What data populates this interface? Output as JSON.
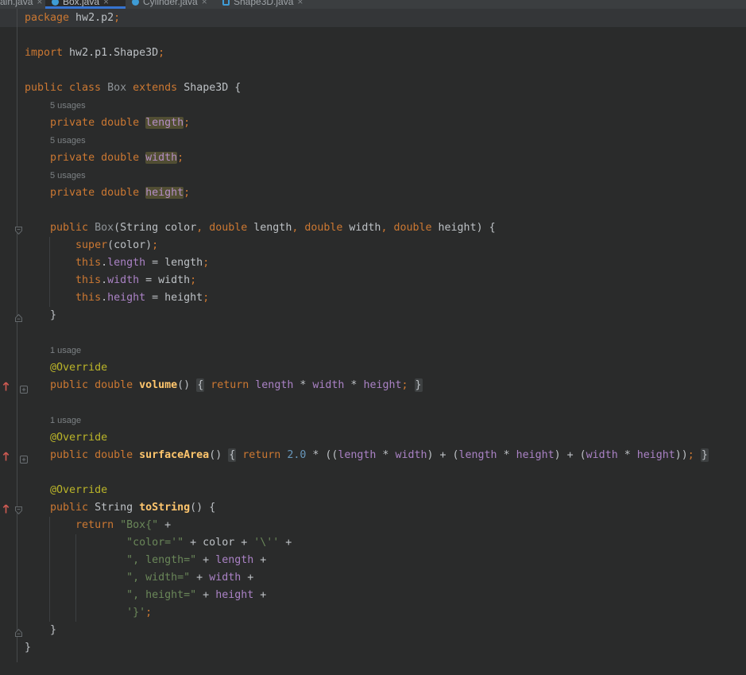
{
  "colors": {
    "editor_background": "#2a2b2b",
    "tabbar_background": "#3b3e40",
    "active_tab_underline": "#3674d0",
    "current_line_highlight": "#343638",
    "keyword": "#cc7832",
    "field": "#aa82c5",
    "field_usage_highlight": "#514e33",
    "method_declaration": "#ffc66d",
    "annotation": "#bbb529",
    "string": "#6a8759",
    "number": "#6897bb",
    "override_arrow": "#ce5a52",
    "java_class_icon_blue": "#3e9cd6"
  },
  "tabs": {
    "items": [
      {
        "label": "ain.java",
        "close": "×",
        "icon": "none",
        "active": false
      },
      {
        "label": "Box.java",
        "close": "×",
        "icon": "java-class",
        "active": true
      },
      {
        "label": "Cylinder.java",
        "close": "×",
        "icon": "java-class",
        "active": false
      },
      {
        "label": "Shape3D.java",
        "close": "×",
        "icon": "java-abstract-class",
        "active": false
      }
    ]
  },
  "editor": {
    "lines": [
      {
        "cur": true,
        "s": [
          [
            "kw",
            "package"
          ],
          [
            "def",
            " hw2.p2"
          ],
          [
            "kw",
            ";"
          ]
        ]
      },
      {
        "s": []
      },
      {
        "s": [
          [
            "kw",
            "import"
          ],
          [
            "def",
            " hw2.p1.Shape3D"
          ],
          [
            "kw",
            ";"
          ]
        ]
      },
      {
        "s": []
      },
      {
        "s": [
          [
            "kw",
            "public class"
          ],
          [
            "def",
            " "
          ],
          [
            "gray",
            "Box"
          ],
          [
            "def",
            " "
          ],
          [
            "kw",
            "extends"
          ],
          [
            "def",
            " Shape3D {"
          ]
        ]
      },
      {
        "inlay": "5 usages"
      },
      {
        "s": [
          [
            "def",
            "    "
          ],
          [
            "kw",
            "private double"
          ],
          [
            "def",
            " "
          ],
          [
            "fldhl",
            "length"
          ],
          [
            "kw",
            ";"
          ]
        ]
      },
      {
        "inlay": "5 usages"
      },
      {
        "s": [
          [
            "def",
            "    "
          ],
          [
            "kw",
            "private double"
          ],
          [
            "def",
            " "
          ],
          [
            "fldhl",
            "width"
          ],
          [
            "kw",
            ";"
          ]
        ]
      },
      {
        "inlay": "5 usages"
      },
      {
        "s": [
          [
            "def",
            "    "
          ],
          [
            "kw",
            "private double"
          ],
          [
            "def",
            " "
          ],
          [
            "fldhl",
            "height"
          ],
          [
            "kw",
            ";"
          ]
        ]
      },
      {
        "s": []
      },
      {
        "g": [
          "fold-start"
        ],
        "s": [
          [
            "def",
            "    "
          ],
          [
            "kw",
            "public"
          ],
          [
            "def",
            " "
          ],
          [
            "gray",
            "Box"
          ],
          [
            "def",
            "(String color"
          ],
          [
            "kw",
            ","
          ],
          [
            "def",
            " "
          ],
          [
            "kw",
            "double"
          ],
          [
            "def",
            " length"
          ],
          [
            "kw",
            ","
          ],
          [
            "def",
            " "
          ],
          [
            "kw",
            "double"
          ],
          [
            "def",
            " width"
          ],
          [
            "kw",
            ","
          ],
          [
            "def",
            " "
          ],
          [
            "kw",
            "double"
          ],
          [
            "def",
            " height) {"
          ]
        ]
      },
      {
        "s": [
          [
            "def",
            "        "
          ],
          [
            "kw",
            "super"
          ],
          [
            "def",
            "(color)"
          ],
          [
            "kw",
            ";"
          ]
        ]
      },
      {
        "s": [
          [
            "def",
            "        "
          ],
          [
            "kw",
            "this"
          ],
          [
            "def",
            "."
          ],
          [
            "fld",
            "length"
          ],
          [
            "def",
            " = length"
          ],
          [
            "kw",
            ";"
          ]
        ]
      },
      {
        "s": [
          [
            "def",
            "        "
          ],
          [
            "kw",
            "this"
          ],
          [
            "def",
            "."
          ],
          [
            "fld",
            "width"
          ],
          [
            "def",
            " = width"
          ],
          [
            "kw",
            ";"
          ]
        ]
      },
      {
        "s": [
          [
            "def",
            "        "
          ],
          [
            "kw",
            "this"
          ],
          [
            "def",
            "."
          ],
          [
            "fld",
            "height"
          ],
          [
            "def",
            " = height"
          ],
          [
            "kw",
            ";"
          ]
        ]
      },
      {
        "g": [
          "fold-end"
        ],
        "s": [
          [
            "def",
            "    }"
          ]
        ]
      },
      {
        "s": []
      },
      {
        "inlay": "1 usage"
      },
      {
        "s": [
          [
            "def",
            "    "
          ],
          [
            "ann",
            "@Override"
          ]
        ]
      },
      {
        "g": [
          "override-arrow",
          "fold-plus"
        ],
        "s": [
          [
            "def",
            "    "
          ],
          [
            "kw",
            "public double"
          ],
          [
            "def",
            " "
          ],
          [
            "mtd",
            "volume"
          ],
          [
            "def",
            "() "
          ],
          [
            "fold",
            "{"
          ],
          [
            "def",
            " "
          ],
          [
            "kw",
            "return"
          ],
          [
            "def",
            " "
          ],
          [
            "fld",
            "length"
          ],
          [
            "def",
            " * "
          ],
          [
            "fld",
            "width"
          ],
          [
            "def",
            " * "
          ],
          [
            "fld",
            "height"
          ],
          [
            "kw",
            ";"
          ],
          [
            "def",
            " "
          ],
          [
            "fold",
            "}"
          ]
        ]
      },
      {
        "s": []
      },
      {
        "inlay": "1 usage"
      },
      {
        "s": [
          [
            "def",
            "    "
          ],
          [
            "ann",
            "@Override"
          ]
        ]
      },
      {
        "g": [
          "override-arrow",
          "fold-plus"
        ],
        "s": [
          [
            "def",
            "    "
          ],
          [
            "kw",
            "public double"
          ],
          [
            "def",
            " "
          ],
          [
            "mtd",
            "surfaceArea"
          ],
          [
            "def",
            "() "
          ],
          [
            "fold",
            "{"
          ],
          [
            "def",
            " "
          ],
          [
            "kw",
            "return"
          ],
          [
            "def",
            " "
          ],
          [
            "num",
            "2.0"
          ],
          [
            "def",
            " * (("
          ],
          [
            "fld",
            "length"
          ],
          [
            "def",
            " * "
          ],
          [
            "fld",
            "width"
          ],
          [
            "def",
            ") + ("
          ],
          [
            "fld",
            "length"
          ],
          [
            "def",
            " * "
          ],
          [
            "fld",
            "height"
          ],
          [
            "def",
            ") + ("
          ],
          [
            "fld",
            "width"
          ],
          [
            "def",
            " * "
          ],
          [
            "fld",
            "height"
          ],
          [
            "def",
            "))"
          ],
          [
            "kw",
            ";"
          ],
          [
            "def",
            " "
          ],
          [
            "fold",
            "}"
          ]
        ]
      },
      {
        "s": []
      },
      {
        "s": [
          [
            "def",
            "    "
          ],
          [
            "ann",
            "@Override"
          ]
        ]
      },
      {
        "g": [
          "override-arrow",
          "fold-start"
        ],
        "s": [
          [
            "def",
            "    "
          ],
          [
            "kw",
            "public"
          ],
          [
            "def",
            " String "
          ],
          [
            "mtd",
            "toString"
          ],
          [
            "def",
            "() {"
          ]
        ]
      },
      {
        "s": [
          [
            "def",
            "        "
          ],
          [
            "kw",
            "return"
          ],
          [
            "def",
            " "
          ],
          [
            "str",
            "\"Box{\""
          ],
          [
            "def",
            " +"
          ]
        ]
      },
      {
        "s": [
          [
            "def",
            "                "
          ],
          [
            "str",
            "\"color='\""
          ],
          [
            "def",
            " + color + "
          ],
          [
            "str",
            "'\\''"
          ],
          [
            "def",
            " +"
          ]
        ]
      },
      {
        "s": [
          [
            "def",
            "                "
          ],
          [
            "str",
            "\", length=\""
          ],
          [
            "def",
            " + "
          ],
          [
            "fld",
            "length"
          ],
          [
            "def",
            " +"
          ]
        ]
      },
      {
        "s": [
          [
            "def",
            "                "
          ],
          [
            "str",
            "\", width=\""
          ],
          [
            "def",
            " + "
          ],
          [
            "fld",
            "width"
          ],
          [
            "def",
            " +"
          ]
        ]
      },
      {
        "s": [
          [
            "def",
            "                "
          ],
          [
            "str",
            "\", height=\""
          ],
          [
            "def",
            " + "
          ],
          [
            "fld",
            "height"
          ],
          [
            "def",
            " +"
          ]
        ]
      },
      {
        "s": [
          [
            "def",
            "                "
          ],
          [
            "str",
            "'}'"
          ],
          [
            "kw",
            ";"
          ]
        ]
      },
      {
        "g": [
          "fold-end"
        ],
        "s": [
          [
            "def",
            "    }"
          ]
        ]
      },
      {
        "s": [
          [
            "def",
            "}"
          ]
        ]
      }
    ]
  }
}
